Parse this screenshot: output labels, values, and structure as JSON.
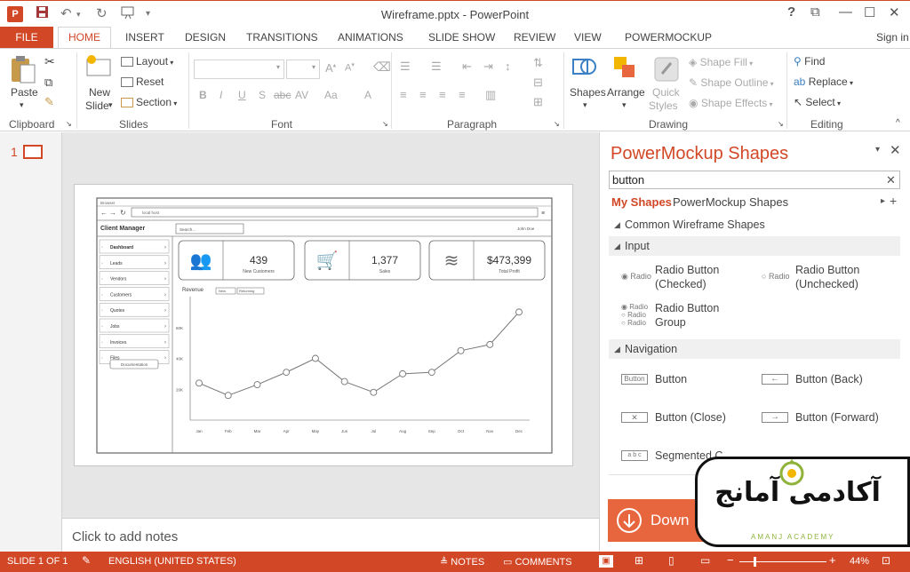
{
  "title": "Wireframe.pptx - PowerPoint",
  "titlebar_controls": [
    "?",
    "⧉",
    "—",
    "☐",
    "✕"
  ],
  "tabs": {
    "file": "FILE",
    "home": "HOME",
    "items": [
      "INSERT",
      "DESIGN",
      "TRANSITIONS",
      "ANIMATIONS",
      "SLIDE SHOW",
      "REVIEW",
      "VIEW",
      "POWERMOCKUP"
    ],
    "sign_in": "Sign in"
  },
  "ribbon": {
    "clipboard": {
      "label": "Clipboard",
      "paste": "Paste"
    },
    "slides": {
      "label": "Slides",
      "new_slide_1": "New",
      "new_slide_2": "Slide",
      "layout": "Layout",
      "reset": "Reset",
      "section": "Section"
    },
    "font": {
      "label": "Font",
      "format_labels": [
        "B",
        "I",
        "U",
        "S",
        "abc",
        "AV",
        "Aa",
        "A"
      ]
    },
    "paragraph": {
      "label": "Paragraph"
    },
    "drawing": {
      "label": "Drawing",
      "shapes": "Shapes",
      "arrange": "Arrange",
      "quick_styles_1": "Quick",
      "quick_styles_2": "Styles",
      "shape_fill": "Shape Fill",
      "shape_outline": "Shape Outline",
      "shape_effects": "Shape Effects"
    },
    "editing": {
      "label": "Editing",
      "find": "Find",
      "replace": "Replace",
      "select": "Select"
    }
  },
  "slide_panel": {
    "number": "1"
  },
  "notes": {
    "placeholder": "Click to add notes"
  },
  "mockup": {
    "browser_title": "Browser",
    "address": "local host",
    "app_title": "Client Manager",
    "search": "Search...",
    "user": "John Doe",
    "nav": [
      "Dashboard",
      "Leads",
      "Vendors",
      "Customers",
      "Quotes",
      "Jobs",
      "Invoices",
      "Files"
    ],
    "doc_button": "Documentation",
    "kpis": [
      {
        "value": "439",
        "label": "New Customers"
      },
      {
        "value": "1,377",
        "label": "Sales"
      },
      {
        "value": "$473,399",
        "label": "Total Profit"
      }
    ],
    "revenue_label": "Revenue",
    "filters": [
      "New",
      "Returning"
    ]
  },
  "chart_data": {
    "type": "line",
    "categories": [
      "Jan",
      "Feb",
      "Mar",
      "Apr",
      "May",
      "Jun",
      "Jul",
      "Aug",
      "Sep",
      "Oct",
      "Nov",
      "Dec"
    ],
    "values": [
      24,
      16,
      23,
      31,
      40,
      25,
      18,
      30,
      31,
      45,
      49,
      70
    ],
    "ylim": [
      0,
      80
    ],
    "yticks": [
      {
        "v": 20,
        "label": "20K"
      },
      {
        "v": 40,
        "label": "40K"
      },
      {
        "v": 60,
        "label": "60K"
      }
    ]
  },
  "pane": {
    "title": "PowerMockup Shapes",
    "search_value": "button",
    "tab_active": "My Shapes",
    "tab_other": "PowerMockup Shapes",
    "cat_common": "Common Wireframe Shapes",
    "cat_input": "Input",
    "cat_navigation": "Navigation",
    "input_items": [
      {
        "label1": "Radio Button",
        "label2": "(Checked)",
        "icon": "Radio"
      },
      {
        "label1": "Radio Button",
        "label2": "(Unchecked)",
        "icon": "Radio"
      },
      {
        "label1": "Radio Button",
        "label2": "Group",
        "icon": "Radio"
      }
    ],
    "nav_items": [
      {
        "label": "Button",
        "icon": "Button"
      },
      {
        "label": "Button (Back)",
        "icon": "←"
      },
      {
        "label": "Button (Close)",
        "icon": "✕"
      },
      {
        "label": "Button (Forward)",
        "icon": "→"
      },
      {
        "label": "Segmented C",
        "icon": "a b c"
      }
    ],
    "download": "Down"
  },
  "status": {
    "slide": "SLIDE 1 OF 1",
    "language": "ENGLISH (UNITED STATES)",
    "notes": "NOTES",
    "comments": "COMMENTS",
    "zoom": "44%"
  },
  "watermark": {
    "text": "آکادمی آمانج",
    "sub": "AMANJ ACADEMY"
  }
}
